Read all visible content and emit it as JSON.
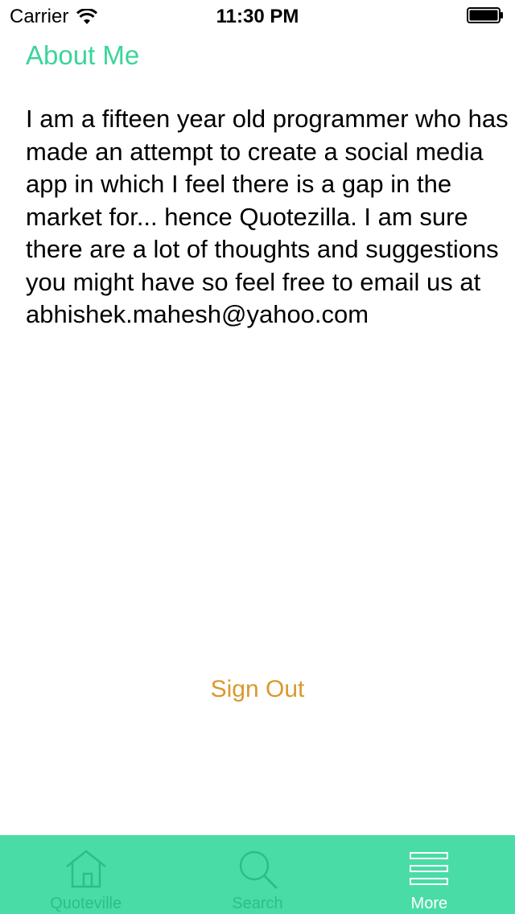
{
  "status_bar": {
    "carrier": "Carrier",
    "time": "11:30 PM"
  },
  "about": {
    "title": "About Me",
    "body": "I am a fifteen year old programmer who has made an attempt to create a social media app in which I feel there is a gap in the market for... hence Quotezilla. I am sure there are a lot of thoughts and suggestions you might have so feel free to email us at abhishek.mahesh@yahoo.com"
  },
  "actions": {
    "sign_out_label": "Sign Out"
  },
  "tab_bar": {
    "tabs": [
      {
        "label": "Quoteville",
        "icon": "home-icon",
        "active": false
      },
      {
        "label": "Search",
        "icon": "search-icon",
        "active": false
      },
      {
        "label": "More",
        "icon": "menu-icon",
        "active": true
      }
    ]
  },
  "colors": {
    "accent_green": "#3ad59a",
    "tab_bar_bg": "#4adca6",
    "tab_inactive": "#2fbd85",
    "sign_out": "#d9992f"
  }
}
